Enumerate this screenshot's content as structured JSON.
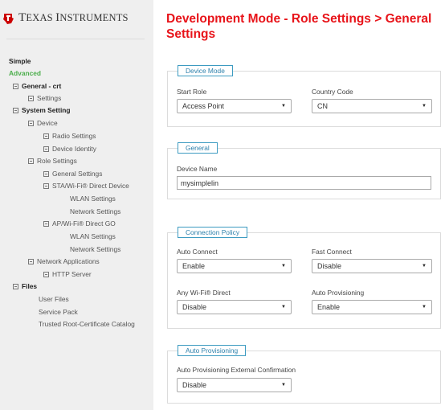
{
  "brand": {
    "logo_text_cap1": "T",
    "logo_text_rest1": "EXAS",
    "logo_text_cap2": "I",
    "logo_text_rest2": "NSTRUMENTS",
    "logo_color": "#cc0000"
  },
  "sidebar": {
    "simple": "Simple",
    "advanced": "Advanced",
    "general": "General - crt",
    "settings": "Settings",
    "system_setting": "System Setting",
    "device": "Device",
    "radio_settings": "Radio Settings",
    "device_identity": "Device Identity",
    "role_settings": "Role Settings",
    "general_settings": "General Settings",
    "sta_wifi_direct": "STA/Wi-Fi® Direct Device",
    "wlan_settings_1": "WLAN Settings",
    "network_settings_1": "Network Settings",
    "ap_wifi_direct_go": "AP/Wi-Fi® Direct GO",
    "wlan_settings_2": "WLAN Settings",
    "network_settings_2": "Network Settings",
    "network_applications": "Network Applications",
    "http_server": "HTTP Server",
    "files": "Files",
    "user_files": "User Files",
    "service_pack": "Service Pack",
    "trusted_root_cert": "Trusted Root-Certificate Catalog"
  },
  "main": {
    "title": "Development Mode - Role Settings > General Settings",
    "device_mode": {
      "legend": "Device Mode",
      "start_role_label": "Start Role",
      "start_role_value": "Access Point",
      "country_code_label": "Country Code",
      "country_code_value": "CN"
    },
    "general": {
      "legend": "General",
      "device_name_label": "Device Name",
      "device_name_value": "mysimplelin"
    },
    "connection_policy": {
      "legend": "Connection Policy",
      "auto_connect_label": "Auto Connect",
      "auto_connect_value": "Enable",
      "fast_connect_label": "Fast Connect",
      "fast_connect_value": "Disable",
      "any_wifi_direct_label": "Any Wi-Fi® Direct",
      "any_wifi_direct_value": "Disable",
      "auto_provisioning_label": "Auto Provisioning",
      "auto_provisioning_value": "Enable"
    },
    "auto_provisioning": {
      "legend": "Auto Provisioning",
      "external_confirmation_label": "Auto Provisioning External Confirmation",
      "external_confirmation_value": "Disable"
    }
  },
  "colors": {
    "title": "#e8141a",
    "advanced": "#4cae4c",
    "legend_border": "#3d9bc1",
    "sidebar_bg": "#efefef"
  }
}
